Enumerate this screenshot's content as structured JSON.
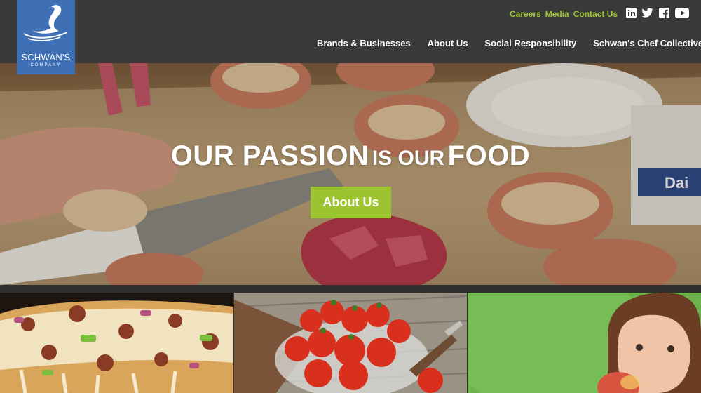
{
  "header": {
    "logo": {
      "name": "SCHWAN'S",
      "sub": "COMPANY"
    },
    "utility_links": [
      "Careers",
      "Media",
      "Contact Us"
    ],
    "social_icons": [
      "linkedin-icon",
      "twitter-icon",
      "facebook-icon",
      "youtube-icon"
    ],
    "nav": [
      "Brands & Businesses",
      "About Us",
      "Social Responsibility",
      "Schwan's Chef Collective"
    ]
  },
  "hero": {
    "title_part1": "OUR PASSION",
    "title_part2": "IS OUR",
    "title_part3": "FOOD",
    "button_label": "About Us"
  },
  "colors": {
    "header_bg": "#3a3a3a",
    "accent_green": "#9cc431",
    "logo_blue": "#3f6fb5"
  }
}
